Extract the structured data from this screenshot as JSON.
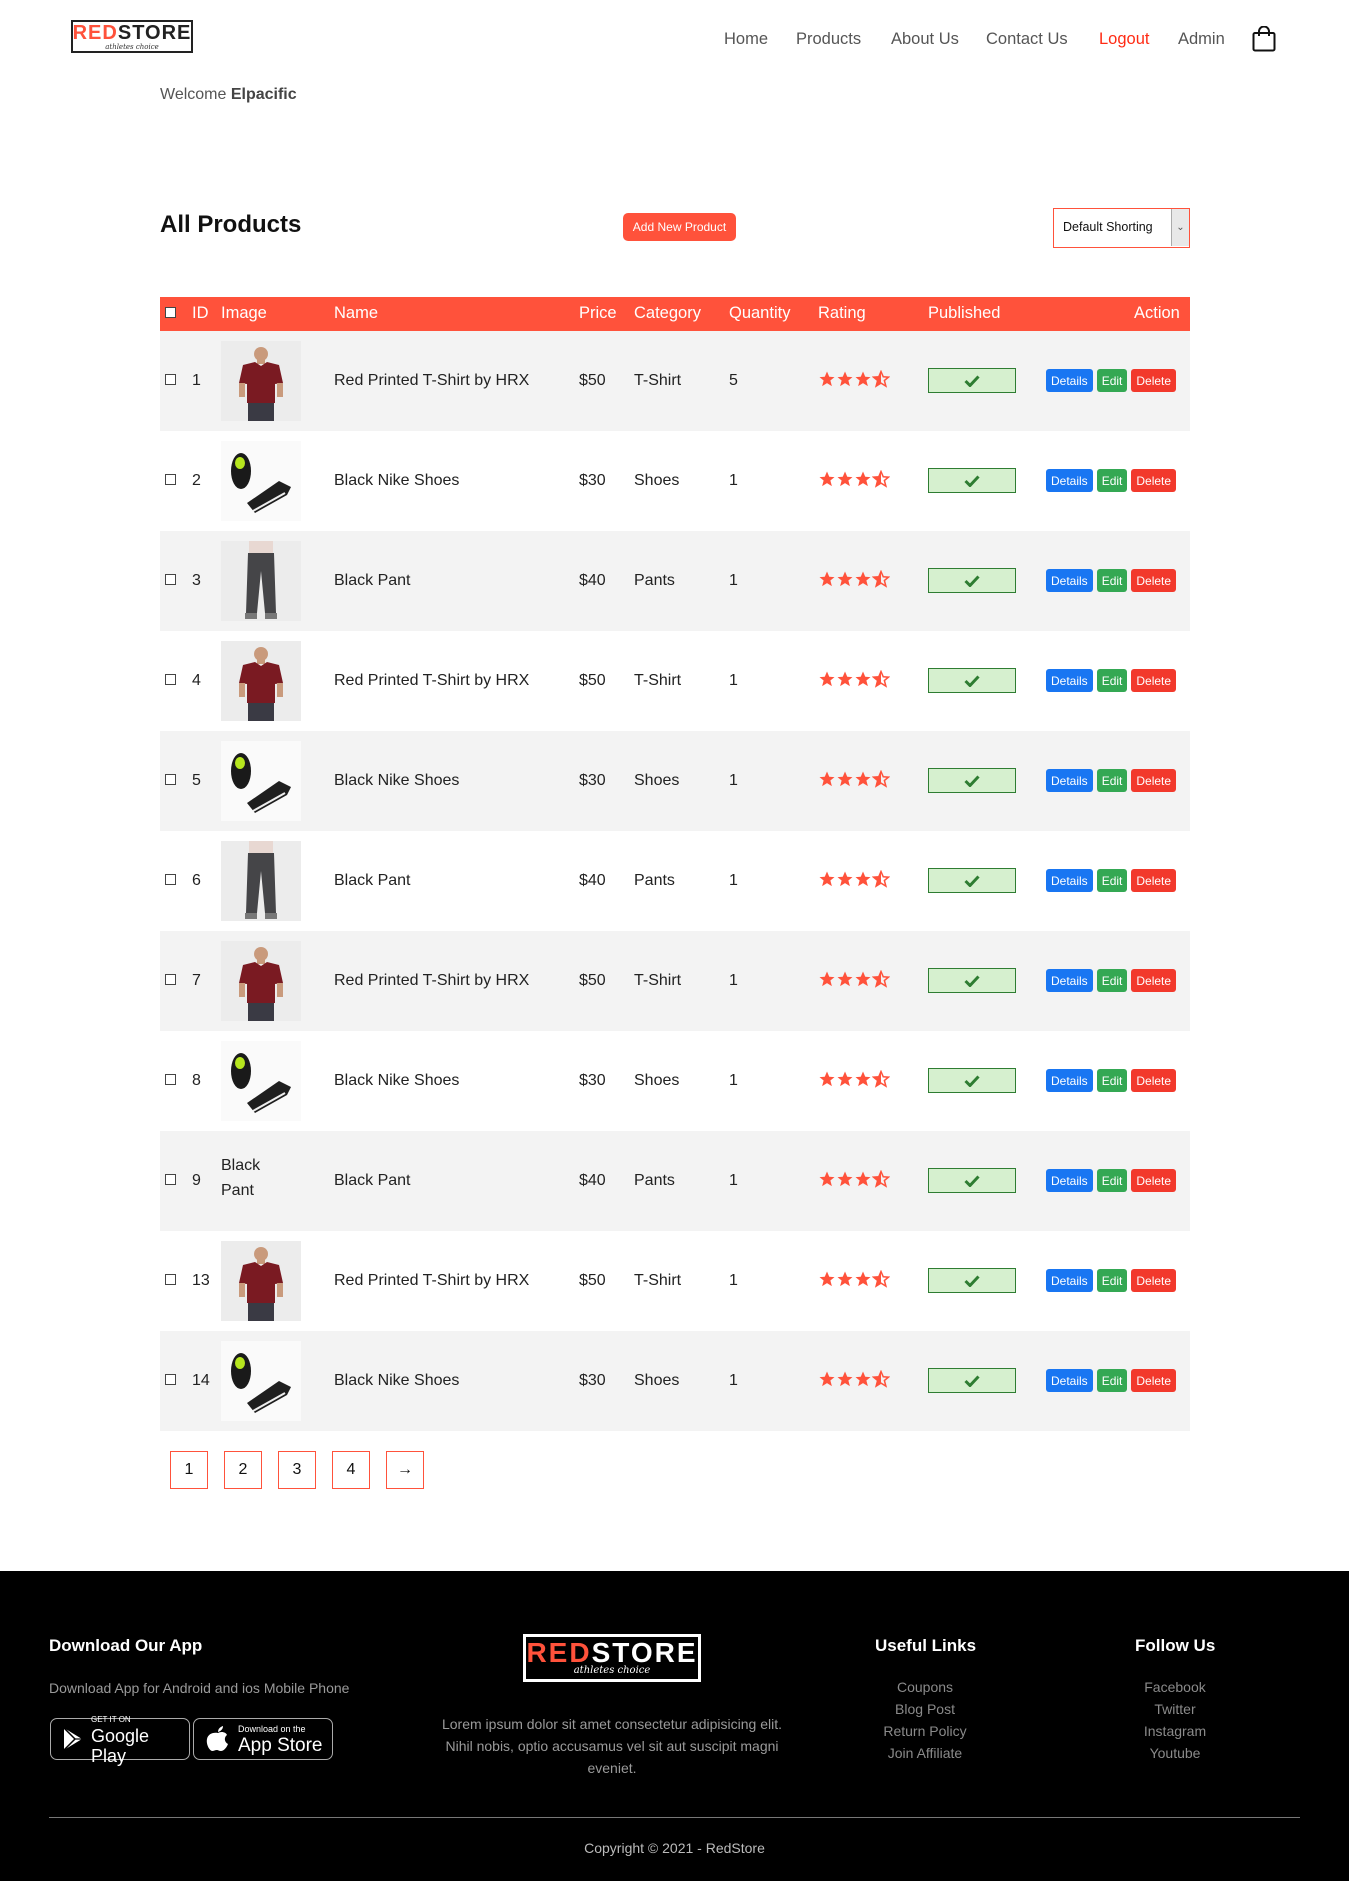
{
  "brand": {
    "name_red": "RE",
    "name_accent": "D",
    "name_rest": "STORE",
    "tagline": "athletes choice"
  },
  "nav": [
    "Home",
    "Products",
    "About Us",
    "Contact Us",
    "Logout",
    "Admin"
  ],
  "welcome": {
    "prefix": "Welcome",
    "user": "Elpacific"
  },
  "page": {
    "title": "All Products",
    "add_button": "Add New Product",
    "sort_value": "Default Shorting"
  },
  "table": {
    "headers": [
      "ID",
      "Image",
      "Name",
      "Price",
      "Category",
      "Quantity",
      "Rating",
      "Published",
      "Action"
    ],
    "actions": {
      "details": "Details",
      "edit": "Edit",
      "delete": "Delete"
    },
    "rows": [
      {
        "id": "1",
        "image": "tshirt",
        "name": "Red Printed T-Shirt by HRX",
        "price": "$50",
        "category": "T-Shirt",
        "quantity": "5",
        "rating": 3.5
      },
      {
        "id": "2",
        "image": "shoes",
        "name": "Black Nike Shoes",
        "price": "$30",
        "category": "Shoes",
        "quantity": "1",
        "rating": 3.5
      },
      {
        "id": "3",
        "image": "pant",
        "name": "Black Pant",
        "price": "$40",
        "category": "Pants",
        "quantity": "1",
        "rating": 3.5
      },
      {
        "id": "4",
        "image": "tshirt",
        "name": "Red Printed T-Shirt by HRX",
        "price": "$50",
        "category": "T-Shirt",
        "quantity": "1",
        "rating": 3.5
      },
      {
        "id": "5",
        "image": "shoes",
        "name": "Black Nike Shoes",
        "price": "$30",
        "category": "Shoes",
        "quantity": "1",
        "rating": 3.5
      },
      {
        "id": "6",
        "image": "pant",
        "name": "Black Pant",
        "price": "$40",
        "category": "Pants",
        "quantity": "1",
        "rating": 3.5
      },
      {
        "id": "7",
        "image": "tshirt",
        "name": "Red Printed T-Shirt by HRX",
        "price": "$50",
        "category": "T-Shirt",
        "quantity": "1",
        "rating": 3.5
      },
      {
        "id": "8",
        "image": "shoes",
        "name": "Black Nike Shoes",
        "price": "$30",
        "category": "Shoes",
        "quantity": "1",
        "rating": 3.5
      },
      {
        "id": "9",
        "image": "missing",
        "image_alt": "Black Pant",
        "name": "Black Pant",
        "price": "$40",
        "category": "Pants",
        "quantity": "1",
        "rating": 3.5
      },
      {
        "id": "13",
        "image": "tshirt",
        "name": "Red Printed T-Shirt by HRX",
        "price": "$50",
        "category": "T-Shirt",
        "quantity": "1",
        "rating": 3.5
      },
      {
        "id": "14",
        "image": "shoes",
        "name": "Black Nike Shoes",
        "price": "$30",
        "category": "Shoes",
        "quantity": "1",
        "rating": 3.5
      }
    ]
  },
  "pagination": [
    "1",
    "2",
    "3",
    "4",
    "→"
  ],
  "footer": {
    "download_title": "Download Our App",
    "download_text": "Download App for Android and ios Mobile Phone",
    "google_small": "GET IT ON",
    "google_big": "Google Play",
    "apple_small": "Download on the",
    "apple_big": "App Store",
    "description": "Lorem ipsum dolor sit amet consectetur adipisicing elit. Nihil nobis, optio accusamus vel sit aut suscipit magni eveniet.",
    "useful_title": "Useful Links",
    "useful_links": [
      "Coupons",
      "Blog Post",
      "Return Policy",
      "Join Affiliate"
    ],
    "follow_title": "Follow Us",
    "follow_links": [
      "Facebook",
      "Twitter",
      "Instagram",
      "Youtube"
    ],
    "copyright": "Copyright © 2021 - RedStore"
  },
  "colors": {
    "accent": "#ff523b",
    "details": "#1976f2",
    "edit": "#34a853",
    "delete": "#f2392c",
    "published_bg": "#d6f0cf"
  }
}
